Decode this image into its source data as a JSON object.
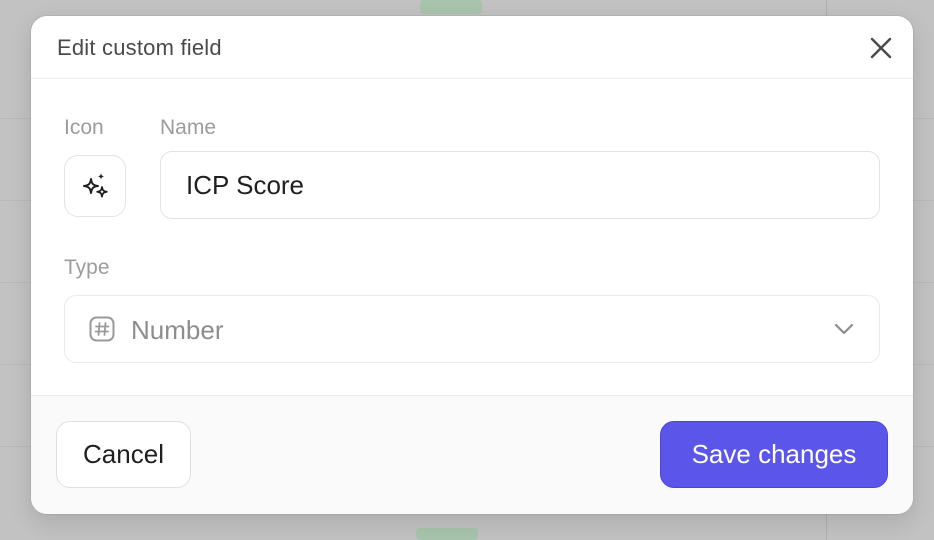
{
  "modal": {
    "title": "Edit custom field",
    "icon_label": "Icon",
    "icon_name": "sparkles-icon",
    "name_label": "Name",
    "name_value": "ICP Score",
    "type_label": "Type",
    "type_value": "Number",
    "type_icon": "hash-icon",
    "cancel_label": "Cancel",
    "save_label": "Save changes"
  },
  "colors": {
    "accent": "#5b55ea",
    "overlay": "#c2c2c2"
  }
}
